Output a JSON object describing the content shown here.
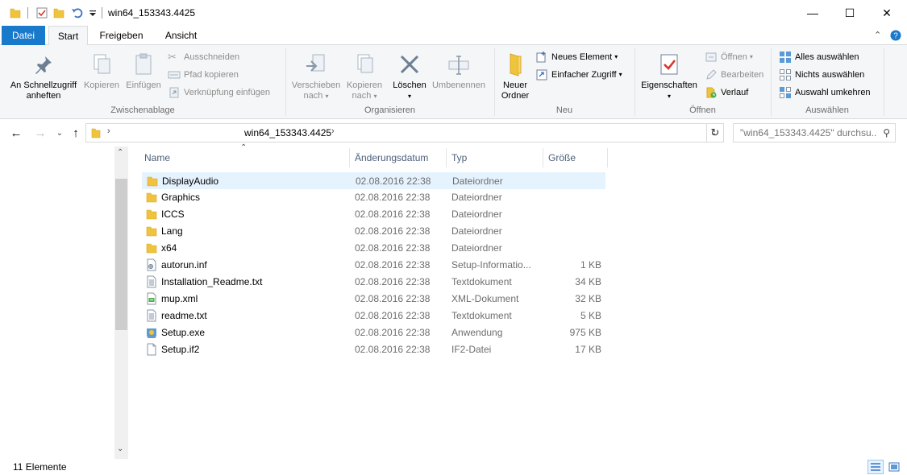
{
  "window": {
    "title": "win64_153343.4425",
    "minimize_glyph": "—",
    "maximize_glyph": "☐",
    "close_glyph": "✕"
  },
  "ribbon_tabs": {
    "file": "Datei",
    "start": "Start",
    "share": "Freigeben",
    "view": "Ansicht"
  },
  "ribbon": {
    "clipboard": {
      "label": "Zwischenablage",
      "pin_line1": "An Schnellzugriff",
      "pin_line2": "anheften",
      "copy": "Kopieren",
      "paste": "Einfügen",
      "cut": "Ausschneiden",
      "copy_path": "Pfad kopieren",
      "paste_shortcut": "Verknüpfung einfügen"
    },
    "organize": {
      "label": "Organisieren",
      "move_line1": "Verschieben",
      "move_line2": "nach",
      "copyto_line1": "Kopieren",
      "copyto_line2": "nach",
      "delete": "Löschen",
      "rename": "Umbenennen"
    },
    "new": {
      "label": "Neu",
      "new_folder_line1": "Neuer",
      "new_folder_line2": "Ordner",
      "new_item": "Neues Element",
      "easy_access": "Einfacher Zugriff"
    },
    "open": {
      "label": "Öffnen",
      "properties": "Eigenschaften",
      "open": "Öffnen",
      "edit": "Bearbeiten",
      "history": "Verlauf"
    },
    "select": {
      "label": "Auswählen",
      "select_all": "Alles auswählen",
      "select_none": "Nichts auswählen",
      "invert": "Auswahl umkehren"
    }
  },
  "address": {
    "path_segment": "win64_153343.4425",
    "search_placeholder": "\"win64_153343.4425\" durchsu..."
  },
  "columns": {
    "name": "Name",
    "date": "Änderungsdatum",
    "type": "Typ",
    "size": "Größe"
  },
  "files": [
    {
      "name": "DisplayAudio",
      "date": "02.08.2016 22:38",
      "type": "Dateiordner",
      "size": "",
      "icon": "folder-icon"
    },
    {
      "name": "Graphics",
      "date": "02.08.2016 22:38",
      "type": "Dateiordner",
      "size": "",
      "icon": "folder-icon"
    },
    {
      "name": "ICCS",
      "date": "02.08.2016 22:38",
      "type": "Dateiordner",
      "size": "",
      "icon": "folder-icon"
    },
    {
      "name": "Lang",
      "date": "02.08.2016 22:38",
      "type": "Dateiordner",
      "size": "",
      "icon": "folder-icon"
    },
    {
      "name": "x64",
      "date": "02.08.2016 22:38",
      "type": "Dateiordner",
      "size": "",
      "icon": "folder-icon"
    },
    {
      "name": "autorun.inf",
      "date": "02.08.2016 22:38",
      "type": "Setup-Informatio...",
      "size": "1 KB",
      "icon": "setup-info-icon"
    },
    {
      "name": "Installation_Readme.txt",
      "date": "02.08.2016 22:38",
      "type": "Textdokument",
      "size": "34 KB",
      "icon": "text-file-icon"
    },
    {
      "name": "mup.xml",
      "date": "02.08.2016 22:38",
      "type": "XML-Dokument",
      "size": "32 KB",
      "icon": "xml-file-icon"
    },
    {
      "name": "readme.txt",
      "date": "02.08.2016 22:38",
      "type": "Textdokument",
      "size": "5 KB",
      "icon": "text-file-icon"
    },
    {
      "name": "Setup.exe",
      "date": "02.08.2016 22:38",
      "type": "Anwendung",
      "size": "975 KB",
      "icon": "setup-exe-icon"
    },
    {
      "name": "Setup.if2",
      "date": "02.08.2016 22:38",
      "type": "IF2-Datei",
      "size": "17 KB",
      "icon": "blank-file-icon"
    }
  ],
  "status": {
    "count": "11 Elemente"
  },
  "colors": {
    "file_tab": "#1979ca",
    "selection": "#e5f3ff",
    "folder": "#f0c33c",
    "header_text": "#4c607a"
  }
}
